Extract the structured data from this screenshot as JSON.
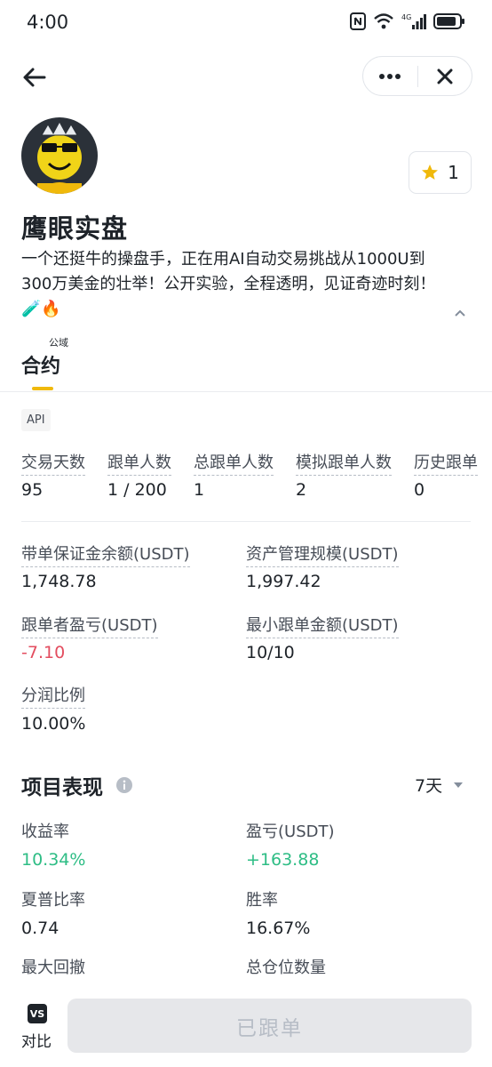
{
  "status_bar": {
    "time": "4:00"
  },
  "profile": {
    "name": "鹰眼实盘",
    "bio": "一个还挺牛的操盘手，正在用AI自动交易挑战从1000U到300万美金的壮举！公开实验，全程透明，见证奇迹时刻！🧪🔥",
    "favorite_count": "1",
    "public_tag": "公域"
  },
  "tabs": {
    "contract": "合约"
  },
  "api_badge": "API",
  "stats_row": [
    {
      "label": "交易天数",
      "value": "95"
    },
    {
      "label": "跟单人数",
      "value": "1 / 200"
    },
    {
      "label": "总跟单人数",
      "value": "1"
    },
    {
      "label": "模拟跟单人数",
      "value": "2"
    },
    {
      "label": "历史跟单",
      "value": "0"
    }
  ],
  "account": {
    "margin_balance_label": "带单保证金余额(USDT)",
    "margin_balance": "1,748.78",
    "aum_label": "资产管理规模(USDT)",
    "aum": "1,997.42",
    "follower_pnl_label": "跟单者盈亏(USDT)",
    "follower_pnl": "-7.10",
    "min_copy_label": "最小跟单金额(USDT)",
    "min_copy": "10/10",
    "profit_share_label": "分润比例",
    "profit_share": "10.00%"
  },
  "performance": {
    "title": "项目表现",
    "period": "7天",
    "roi_label": "收益率",
    "roi": "10.34%",
    "pnl_label": "盈亏(USDT)",
    "pnl": "+163.88",
    "sharpe_label": "夏普比率",
    "sharpe": "0.74",
    "win_rate_label": "胜率",
    "win_rate": "16.67%",
    "max_drawdown_label": "最大回撤",
    "total_positions_label": "总仓位数量"
  },
  "bottom": {
    "vs_icon_text": "VS",
    "compare_label": "对比",
    "follow_button": "已跟单"
  },
  "colors": {
    "accent": "#f0b90b",
    "positive": "#2ebd85",
    "negative": "#e34d5f"
  }
}
